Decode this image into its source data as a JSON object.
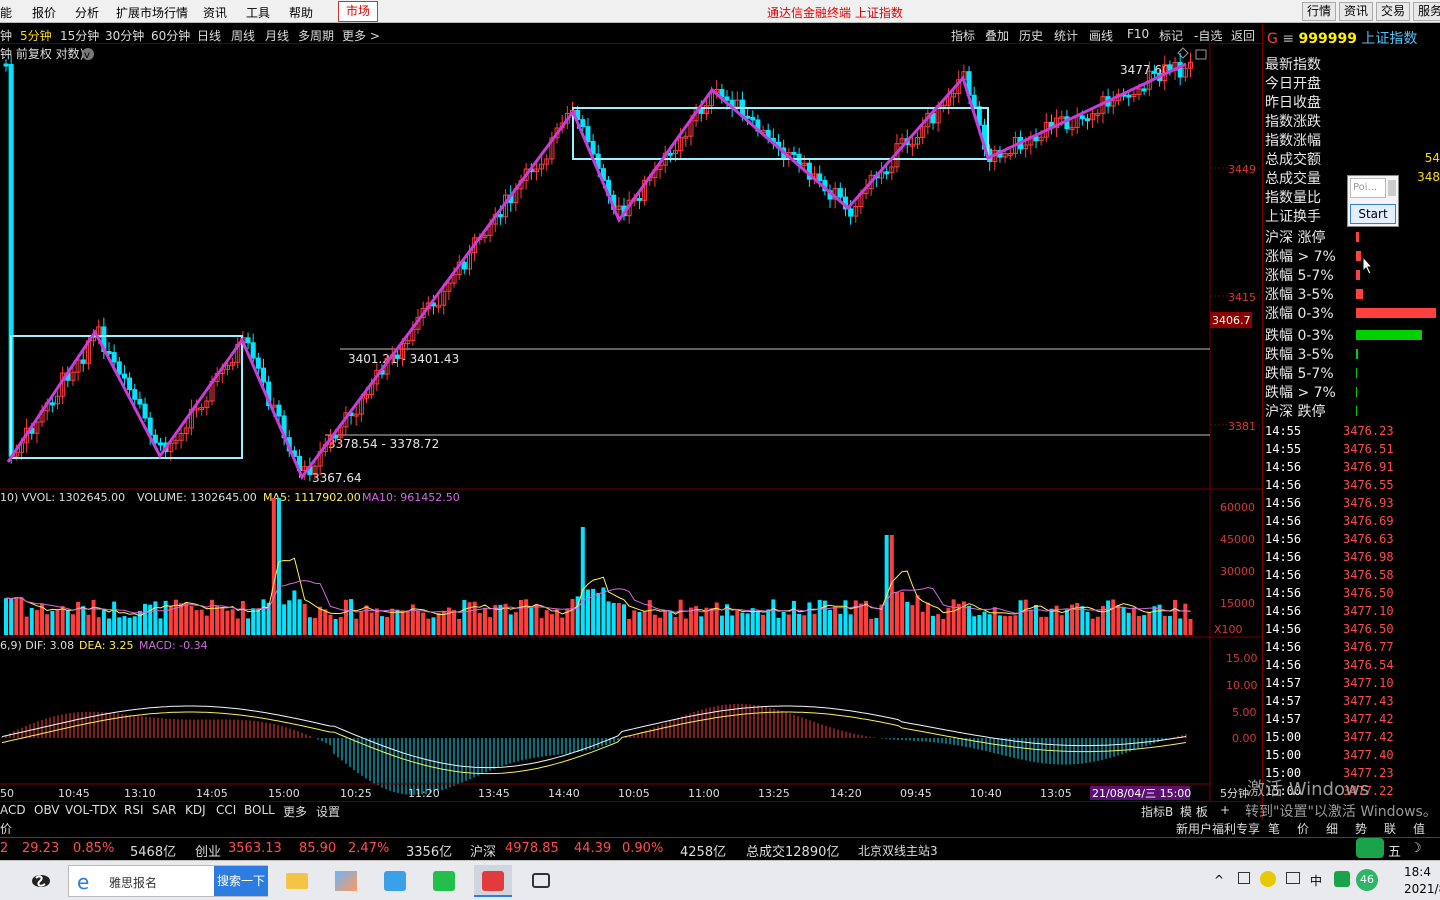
{
  "menubar": {
    "items": [
      "能",
      "报价",
      "分析",
      "扩展市场行情",
      "资讯",
      "工具",
      "帮助"
    ],
    "market_tab": "市场",
    "title": "通达信金融终端 上证指数",
    "right_buttons": [
      "行情",
      "资讯",
      "交易",
      "服务"
    ]
  },
  "toolbar": {
    "periods": [
      "钟",
      "5分钟",
      "15分钟",
      "30分钟",
      "60分钟",
      "日线",
      "周线",
      "月线",
      "多周期",
      "更多 >"
    ],
    "active_period": "5分钟",
    "tools": [
      "指标",
      "叠加",
      "历史",
      "统计",
      "画线",
      "F10",
      "标记",
      "-自选",
      "返回"
    ]
  },
  "chart": {
    "subtitle": "钟 前复权 对数)",
    "price_axis_labels": [
      "3449",
      "3415",
      "3381"
    ],
    "current_price_tag": "3406.7",
    "high_label": "3477.60",
    "low_label": "3367.64",
    "support_line_1": "3401.21 - 3401.43",
    "support_line_2": "3378.54 - 3378.72",
    "vol_header": {
      "a": "10) VVOL: 1302645.00",
      "b": "VOLUME: 1302645.00",
      "c": "MA5: 1117902.00",
      "d": "MA10: 961452.50"
    },
    "vol_axis_labels": [
      "60000",
      "45000",
      "30000",
      "15000",
      "X100"
    ],
    "macd_header": {
      "a": "6,9) DIF: 3.08",
      "b": "DEA: 3.25",
      "c": "MACD: -0.34"
    },
    "macd_axis_labels": [
      "15.00",
      "10.00",
      "5.00",
      "0.00"
    ],
    "time_labels": [
      "50",
      "10:45",
      "13:10",
      "14:05",
      "15:00",
      "10:25",
      "11:20",
      "13:45",
      "14:40",
      "10:05",
      "11:00",
      "13:25",
      "14:20",
      "09:45",
      "10:40",
      "13:05"
    ],
    "time_cursor": "21/08/04/三 15:00",
    "period_label": "5分钟",
    "colors": {
      "up": "#ff3d3d",
      "down": "#00e5ff",
      "zigzag": "#c83cd8",
      "box": "#9af0ff",
      "dif": "#f5f5f5",
      "dea": "#ffee58",
      "ma10": "#d06be0"
    }
  },
  "right_panel": {
    "index_header": {
      "g": "G",
      "eq": "≡",
      "code": "999999",
      "name": "上证指数"
    },
    "stats": [
      {
        "label": "最新指数",
        "value": ""
      },
      {
        "label": "今日开盘",
        "value": ""
      },
      {
        "label": "昨日收盘",
        "value": ""
      },
      {
        "label": "指数涨跌",
        "value": ""
      },
      {
        "label": "指数涨幅",
        "value": ""
      },
      {
        "label": "总成交额",
        "value": "54"
      },
      {
        "label": "总成交量",
        "value": "348"
      },
      {
        "label": "指数量比",
        "value": ""
      },
      {
        "label": "上证换手",
        "value": ""
      }
    ],
    "breadth": [
      {
        "label": "沪深 涨停",
        "fill": 0.04,
        "color": "#ff4040"
      },
      {
        "label": "涨幅 > 7%",
        "fill": 0.06,
        "color": "#ff4040"
      },
      {
        "label": "涨幅 5-7%",
        "fill": 0.05,
        "color": "#ff4040"
      },
      {
        "label": "涨幅 3-5%",
        "fill": 0.09,
        "color": "#ff4040"
      },
      {
        "label": "涨幅 0-3%",
        "fill": 0.97,
        "color": "#ff4040"
      },
      {
        "label": "跌幅 0-3%",
        "fill": 0.8,
        "color": "#00d000"
      },
      {
        "label": "跌幅 3-5%",
        "fill": 0.03,
        "color": "#00d000"
      },
      {
        "label": "跌幅 5-7%",
        "fill": 0.01,
        "color": "#00d000"
      },
      {
        "label": "跌幅 > 7%",
        "fill": 0.01,
        "color": "#00d000"
      },
      {
        "label": "沪深 跌停",
        "fill": 0.01,
        "color": "#00d000"
      }
    ],
    "ticks": [
      {
        "t": "14:55",
        "p": "3476.23"
      },
      {
        "t": "14:55",
        "p": "3476.51"
      },
      {
        "t": "14:56",
        "p": "3476.91"
      },
      {
        "t": "14:56",
        "p": "3476.55"
      },
      {
        "t": "14:56",
        "p": "3476.93"
      },
      {
        "t": "14:56",
        "p": "3476.69"
      },
      {
        "t": "14:56",
        "p": "3476.63"
      },
      {
        "t": "14:56",
        "p": "3476.98"
      },
      {
        "t": "14:56",
        "p": "3476.58"
      },
      {
        "t": "14:56",
        "p": "3476.50"
      },
      {
        "t": "14:56",
        "p": "3477.10"
      },
      {
        "t": "14:56",
        "p": "3476.50"
      },
      {
        "t": "14:56",
        "p": "3476.77"
      },
      {
        "t": "14:56",
        "p": "3476.54"
      },
      {
        "t": "14:57",
        "p": "3477.10"
      },
      {
        "t": "14:57",
        "p": "3477.43"
      },
      {
        "t": "14:57",
        "p": "3477.42"
      },
      {
        "t": "15:00",
        "p": "3477.42"
      },
      {
        "t": "15:00",
        "p": "3477.40"
      },
      {
        "t": "15:00",
        "p": "3477.23"
      },
      {
        "t": "15:00",
        "p": "3477.22"
      }
    ]
  },
  "popup": {
    "input_placeholder": "Poi...",
    "start_label": "Start"
  },
  "indicator_bar": [
    "ACD",
    "OBV",
    "VOL-TDX",
    "RSI",
    "SAR",
    "KDJ",
    "CCI",
    "BOLL",
    "更多",
    "设置"
  ],
  "indicator_bar_right": [
    "指标B",
    "模 板",
    "+"
  ],
  "indicator_bar2": {
    "left": "价",
    "right_promo": "新用户福利专享",
    "tabs": [
      "笔",
      "价",
      "细",
      "势",
      "联",
      "值"
    ]
  },
  "statusbar": {
    "seg1": {
      "a": "2",
      "b": "29.23",
      "c": "0.85%",
      "d": "5468亿"
    },
    "seg2": {
      "name": "创业",
      "price": "3563.13",
      "chg": "85.90",
      "pct": "2.47%",
      "amt": "3356亿"
    },
    "seg3": {
      "name": "沪深",
      "price": "4978.85",
      "chg": "44.39",
      "pct": "0.90%",
      "amt": "4258亿"
    },
    "total": "总成交12890亿",
    "server": "北京双线主站3"
  },
  "taskbar": {
    "search_text": "雅思报名",
    "search_button": "搜索一下",
    "tray_ime": "中",
    "tray_ime2": "五",
    "tray_badge": "46",
    "clock_time": "18:4",
    "clock_date": "2021/8"
  },
  "watermark": {
    "line1": "激活 Windows",
    "line2": "转到\"设置\"以激活 Windows。"
  }
}
